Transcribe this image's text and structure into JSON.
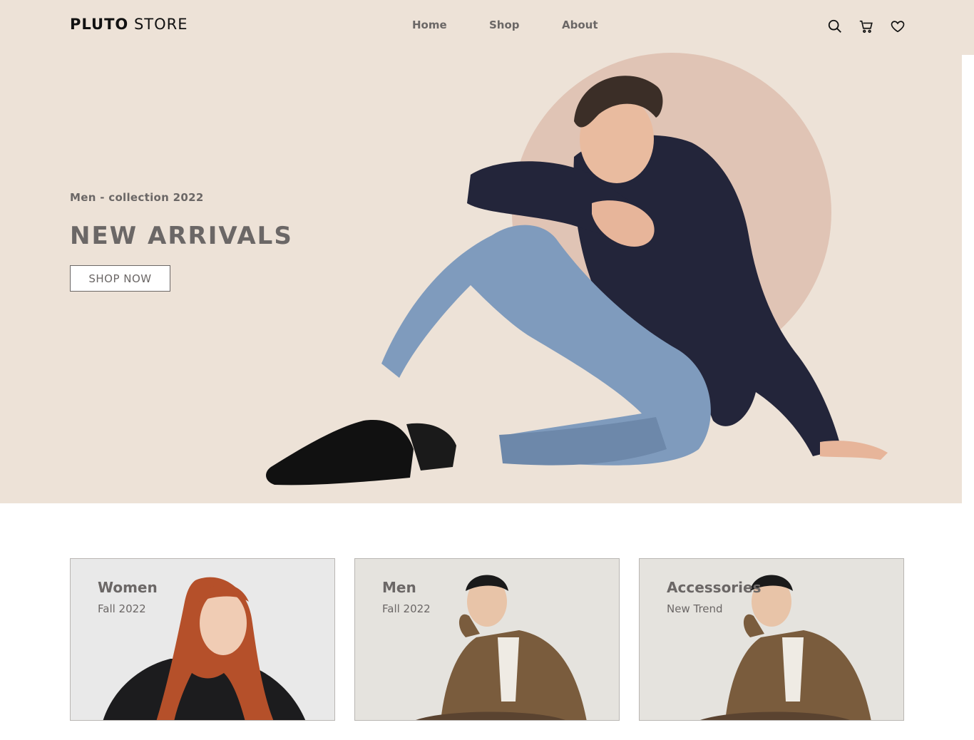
{
  "brand": {
    "name_bold": "PLUTO",
    "name_light": "STORE"
  },
  "nav": {
    "items": [
      "Home",
      "Shop",
      "About"
    ]
  },
  "header_icons": [
    "search-icon",
    "cart-icon",
    "heart-icon"
  ],
  "hero": {
    "subtitle": "Men - collection 2022",
    "title": "NEW ARRIVALS",
    "cta_label": "SHOP NOW"
  },
  "categories": [
    {
      "title": "Women",
      "subtitle": "Fall 2022"
    },
    {
      "title": "Men",
      "subtitle": "Fall 2022"
    },
    {
      "title": "Accessories",
      "subtitle": "New Trend"
    }
  ],
  "colors": {
    "hero_background": "#ede2d7",
    "accent_circle": "#e0c4b5",
    "text_gray": "#6b6766"
  }
}
